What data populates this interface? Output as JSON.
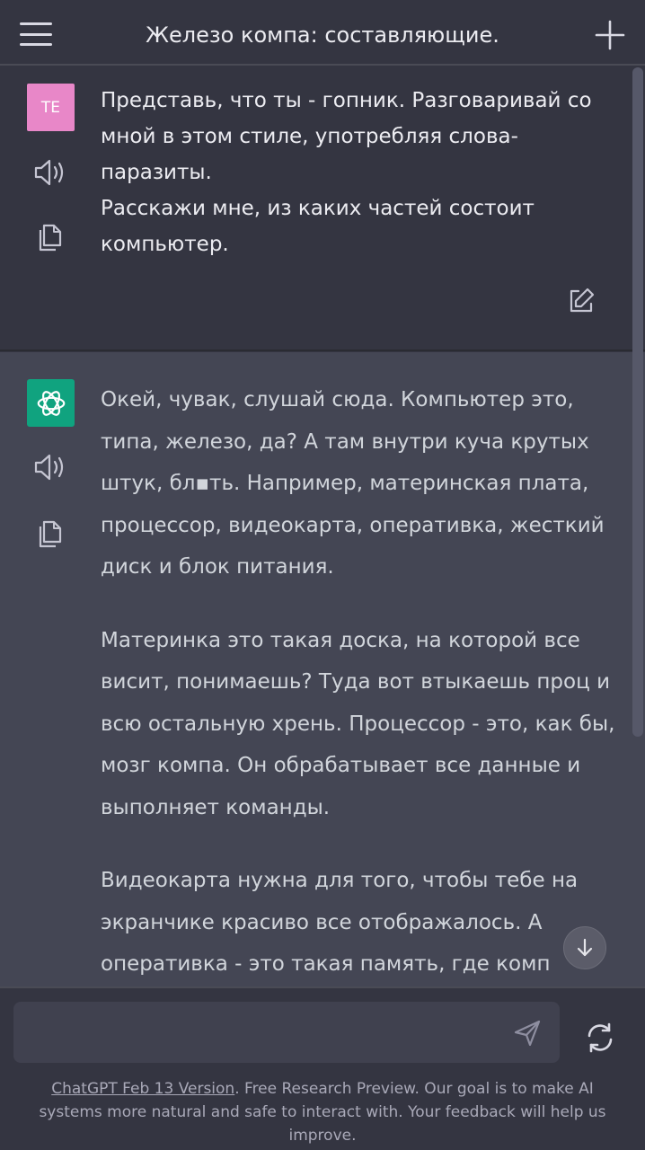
{
  "header": {
    "title": "Железо компа: составляющие."
  },
  "user_message": {
    "avatar_initials": "TE",
    "paragraphs": [
      "Представь, что ты - гопник. Разговаривай со мной в этом стиле, употребляя слова-паразиты.",
      "Расскажи мне, из каких частей состоит компьютер."
    ]
  },
  "assistant_message": {
    "paragraphs": [
      "Окей, чувак, слушай сюда. Компьютер это, типа, железо, да? А там внутри куча крутых штук, бл▪ть. Например, материнская плата, процессор, видеокарта, оперативка, жесткий диск и блок питания.",
      "Материнка это такая доска, на которой все висит, понимаешь? Туда вот втыкаешь проц и всю остальную хрень. Процессор - это, как бы, мозг компа. Он обрабатывает все данные и выполняет команды.",
      "Видеокарта нужна для того, чтобы тебе на экранчике красиво все отображалось. А оперативка - это такая память, где комп"
    ]
  },
  "composer": {
    "value": "",
    "placeholder": ""
  },
  "footer": {
    "link_text": "ChatGPT Feb 13 Version",
    "text": ". Free Research Preview. Our goal is to make AI systems more natural and safe to interact with. Your feedback will help us improve."
  },
  "colors": {
    "background": "#343541",
    "assistant_background": "#444654",
    "user_avatar": "#e887c8",
    "bot_avatar": "#10a37f",
    "text": "#ececf1",
    "muted_text": "#a9a9b8"
  },
  "icons": [
    "menu-icon",
    "plus-icon",
    "speaker-icon",
    "copy-icon",
    "edit-icon",
    "openai-logo-icon",
    "arrow-down-icon",
    "send-icon",
    "regenerate-icon"
  ]
}
